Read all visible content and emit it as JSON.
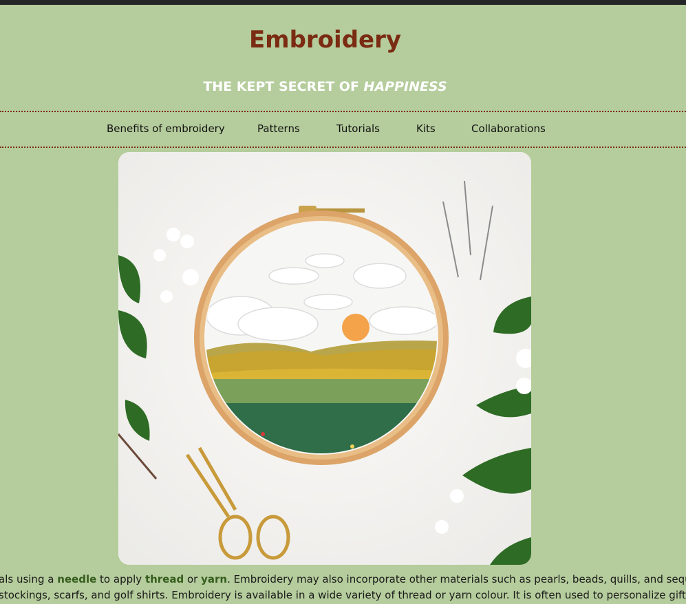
{
  "page": {
    "title": "Embroidery",
    "subtitle_main": "THE KEPT SECRET OF ",
    "subtitle_emphasis": "HAPPINESS"
  },
  "nav": {
    "items": [
      {
        "label": "Benefits of embroidery"
      },
      {
        "label": "Patterns"
      },
      {
        "label": "Tutorials"
      },
      {
        "label": "Kits"
      },
      {
        "label": "Collaborations"
      }
    ]
  },
  "hero": {
    "icon": "embroidery-hoop-image"
  },
  "intro": {
    "line1_a": "als using a ",
    "line1_needle": "needle",
    "line1_b": " to apply ",
    "line1_thread": "thread",
    "line1_c": " or ",
    "line1_yarn": "yarn",
    "line1_d": ". Embroidery may also incorporate other materials such as pearls, beads, quills, and sequins.",
    "line2": " stockings, scarfs, and golf shirts. Embroidery is available in a wide variety of thread or yarn colour. It is often used to personalize gifts"
  },
  "colors": {
    "background": "#b5cc9c",
    "title": "#7a2b12",
    "link_highlight": "#355e1e"
  }
}
